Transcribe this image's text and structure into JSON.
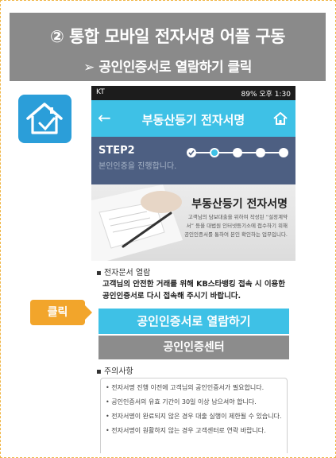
{
  "header": {
    "line1": "② 통합 모바일 전자서명 어플 구동",
    "line2": "➢ 공인인증서로 열람하기 클릭"
  },
  "status_bar": {
    "carrier": "KT",
    "right": "89% 오후 1:30"
  },
  "app_bar": {
    "title": "부동산등기 전자서명"
  },
  "step": {
    "label": "STEP2",
    "subtitle": "본인인증을 진행합니다.",
    "current": 2,
    "total": 5
  },
  "hero": {
    "title": "부동산등기 전자서명",
    "text": "고객님의 담보대출을 위하여 작성된 “설정계약서” 등을 대법원 인터넷등기소에 접수하기 위해 공인인증서를 통하여 본인 확인하는 업무입니다."
  },
  "notice": {
    "heading": "▪ 전자문서 열람",
    "body": "고객님의 안전한 거래를 위해 KB스타뱅킹 접속 시 이용한 공인인증서로 다시 접속해 주시기 바랍니다."
  },
  "buttons": {
    "view_with_cert": "공인인증서로 열람하기",
    "cert_center": "공인인증센터"
  },
  "cautions": {
    "heading": "▪ 주의사항",
    "items": [
      "• 전자서명 진행 이전에 고객님의 공인인증서가 필요합니다.",
      "• 공인인증서의 유효 기간이 30일 이상 남으셔야 합니다.",
      "• 전자서명이 완료되지 않은 경우 대출 실행이 제한될 수 있습니다.",
      "• 전자서명이 원활하지 않는 경우 고객센터로 연락 바랍니다."
    ]
  },
  "click_tag": "클릭",
  "colors": {
    "accent": "#3ec1e6",
    "step_band": "#4d5f82",
    "header_bg": "#8a8a8a",
    "click_tag": "#f2a52b",
    "frame_border": "#f0b545",
    "app_icon": "#2b9ed9"
  },
  "icons": {
    "app": "home-document-icon",
    "back": "back-arrow-icon",
    "home": "home-icon"
  }
}
